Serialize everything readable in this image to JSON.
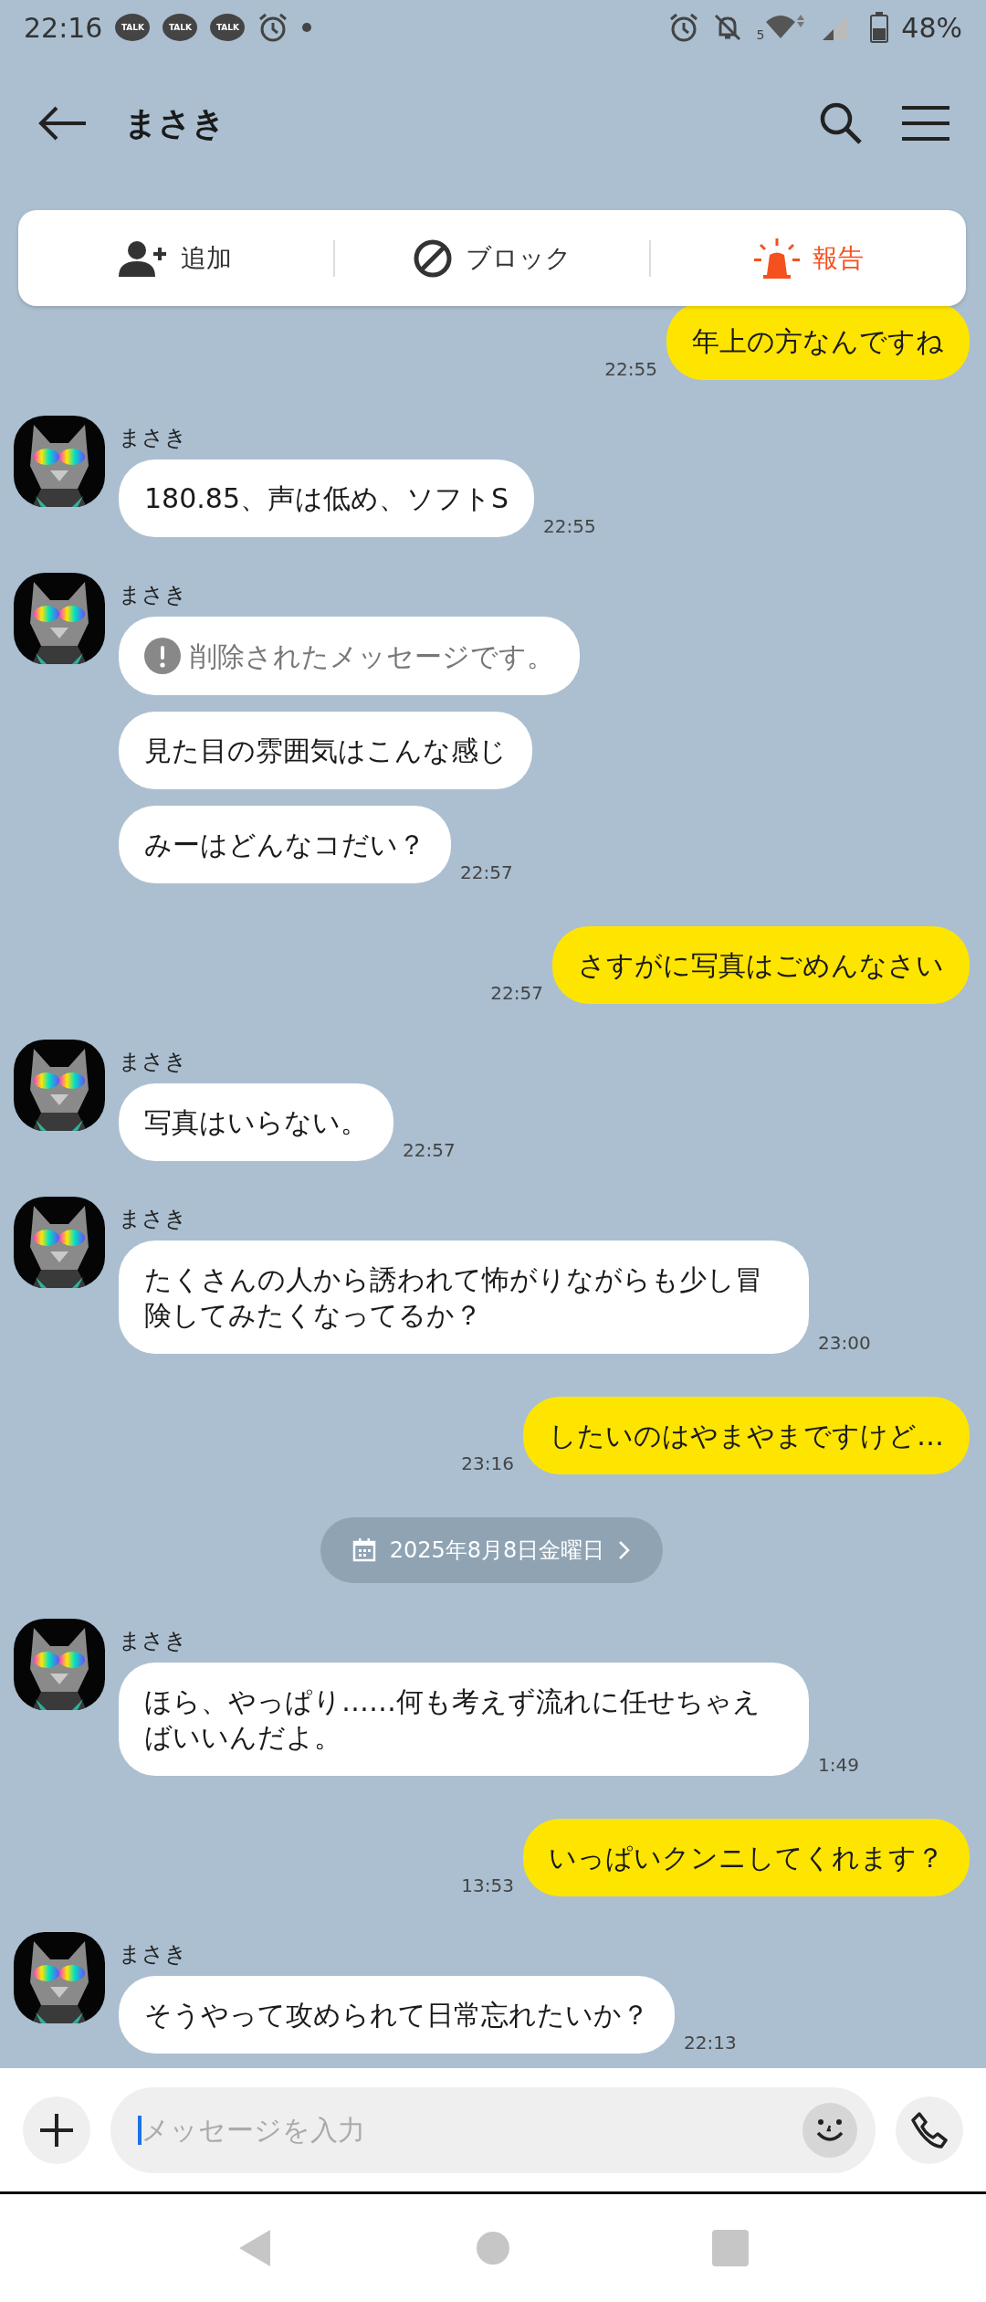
{
  "status_bar": {
    "time": "22:16",
    "notifications": [
      "TALK",
      "TALK",
      "TALK"
    ],
    "wifi_label": "5",
    "battery": "48%"
  },
  "header": {
    "title": "まさき"
  },
  "action_bar": [
    {
      "kind": "add",
      "label": "追加"
    },
    {
      "kind": "block",
      "label": "ブロック"
    },
    {
      "kind": "report",
      "label": "報告"
    }
  ],
  "messages": [
    {
      "kind": "sent",
      "text": "年上の方なんですね",
      "time": "22:55"
    },
    {
      "kind": "received",
      "sender": "まさき",
      "bubbles": [
        {
          "text": "180.85、声は低め、ソフトS",
          "deleted": false,
          "time": "22:55"
        }
      ]
    },
    {
      "kind": "received",
      "sender": "まさき",
      "bubbles": [
        {
          "text": "削除されたメッセージです。",
          "deleted": true
        },
        {
          "text": "見た目の雰囲気はこんな感じ",
          "deleted": false
        },
        {
          "text": "みーはどんなコだい？",
          "deleted": false,
          "time": "22:57"
        }
      ]
    },
    {
      "kind": "sent",
      "text": "さすがに写真はごめんなさい",
      "time": "22:57"
    },
    {
      "kind": "received",
      "sender": "まさき",
      "bubbles": [
        {
          "text": "写真はいらない。",
          "deleted": false,
          "time": "22:57"
        }
      ]
    },
    {
      "kind": "received",
      "sender": "まさき",
      "bubbles": [
        {
          "text": "たくさんの人から誘われて怖がりながらも少し冒険してみたくなってるか？",
          "deleted": false,
          "time": "23:00"
        }
      ]
    },
    {
      "kind": "sent",
      "text": "したいのはやまやまですけど…",
      "time": "23:16"
    },
    {
      "kind": "date",
      "text": "2025年8月8日金曜日"
    },
    {
      "kind": "received",
      "sender": "まさき",
      "bubbles": [
        {
          "text": "ほら、やっぱり……何も考えず流れに任せちゃえばいいんだよ。",
          "deleted": false,
          "time": "1:49"
        }
      ]
    },
    {
      "kind": "sent",
      "text": "いっぱいクンニしてくれます？",
      "time": "13:53"
    },
    {
      "kind": "received",
      "sender": "まさき",
      "bubbles": [
        {
          "text": "そうやって攻められて日常忘れたいか？",
          "deleted": false,
          "time": "22:13"
        }
      ]
    }
  ],
  "composer": {
    "placeholder": "メッセージを入力"
  }
}
